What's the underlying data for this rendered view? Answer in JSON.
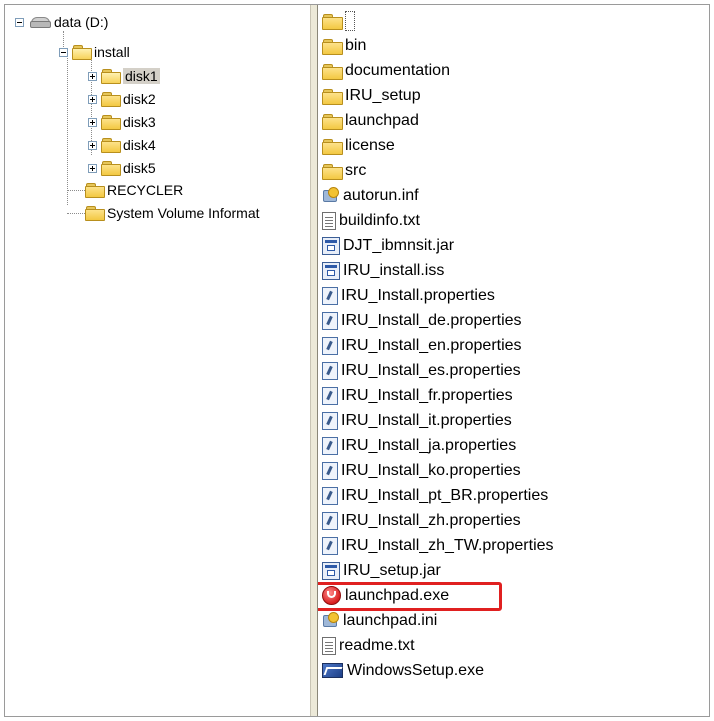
{
  "tree": {
    "drive_label": "data (D:)",
    "install_label": "install",
    "disks": [
      "disk1",
      "disk2",
      "disk3",
      "disk4",
      "disk5"
    ],
    "selected_disk": "disk1",
    "recycler_label": "RECYCLER",
    "system_volume_label": "System Volume Informat"
  },
  "files": [
    {
      "name": "",
      "type": "folder-up"
    },
    {
      "name": "bin",
      "type": "folder"
    },
    {
      "name": "documentation",
      "type": "folder"
    },
    {
      "name": "IRU_setup",
      "type": "folder"
    },
    {
      "name": "launchpad",
      "type": "folder"
    },
    {
      "name": "license",
      "type": "folder"
    },
    {
      "name": "src",
      "type": "folder"
    },
    {
      "name": "autorun.inf",
      "type": "inf"
    },
    {
      "name": "buildinfo.txt",
      "type": "txt"
    },
    {
      "name": "DJT_ibmnsit.jar",
      "type": "jar"
    },
    {
      "name": "IRU_install.iss",
      "type": "jar"
    },
    {
      "name": "IRU_Install.properties",
      "type": "prop"
    },
    {
      "name": "IRU_Install_de.properties",
      "type": "prop"
    },
    {
      "name": "IRU_Install_en.properties",
      "type": "prop"
    },
    {
      "name": "IRU_Install_es.properties",
      "type": "prop"
    },
    {
      "name": "IRU_Install_fr.properties",
      "type": "prop"
    },
    {
      "name": "IRU_Install_it.properties",
      "type": "prop"
    },
    {
      "name": "IRU_Install_ja.properties",
      "type": "prop"
    },
    {
      "name": "IRU_Install_ko.properties",
      "type": "prop"
    },
    {
      "name": "IRU_Install_pt_BR.properties",
      "type": "prop"
    },
    {
      "name": "IRU_Install_zh.properties",
      "type": "prop"
    },
    {
      "name": "IRU_Install_zh_TW.properties",
      "type": "prop"
    },
    {
      "name": "IRU_setup.jar",
      "type": "jar"
    },
    {
      "name": "launchpad.exe",
      "type": "lpexe",
      "highlighted": true
    },
    {
      "name": "launchpad.ini",
      "type": "inf"
    },
    {
      "name": "readme.txt",
      "type": "txt"
    },
    {
      "name": "WindowsSetup.exe",
      "type": "setup"
    }
  ],
  "colors": {
    "highlight": "#e02020",
    "selection": "#d4d0c8"
  }
}
